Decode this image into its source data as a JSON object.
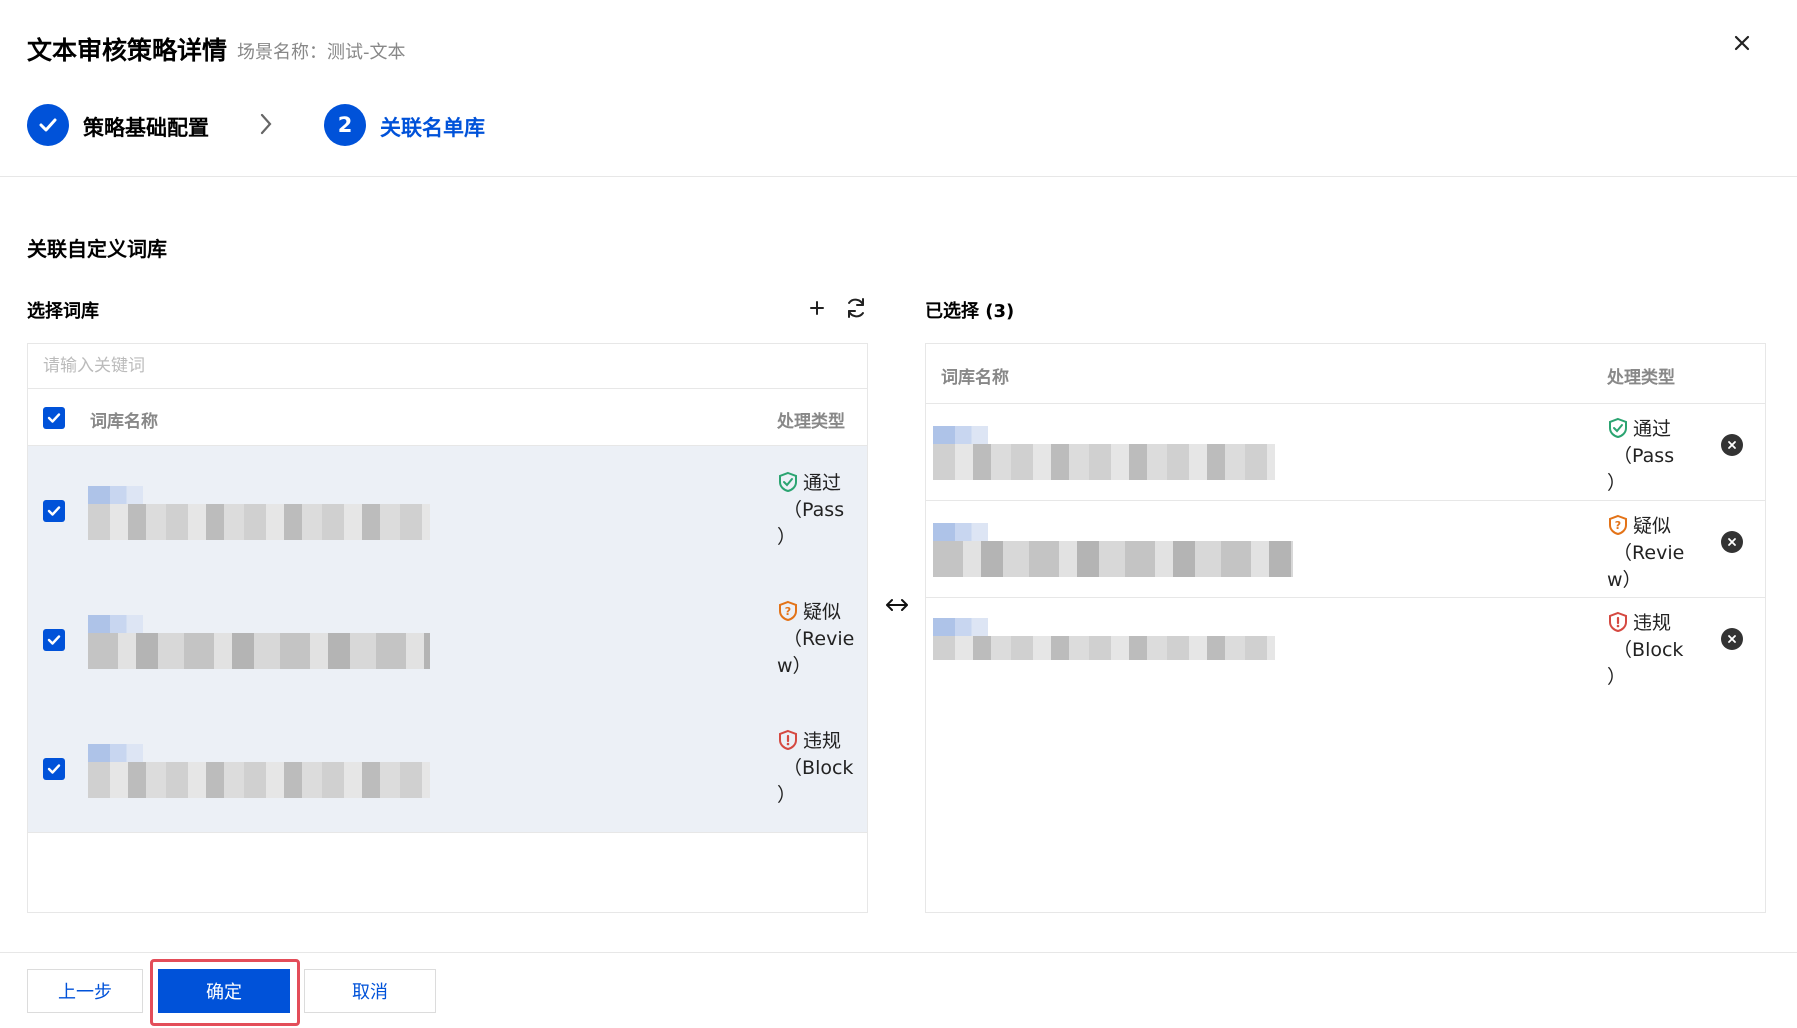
{
  "dialog": {
    "title": "文本审核策略详情",
    "scene": "场景名称：测试-文本"
  },
  "steps": [
    {
      "label": "策略基础配置",
      "status": "done"
    },
    {
      "number": "2",
      "label": "关联名单库",
      "status": "active"
    }
  ],
  "section": {
    "title": "关联自定义词库"
  },
  "left": {
    "title": "选择词库",
    "search_placeholder": "请输入关键词",
    "col_name": "词库名称",
    "col_type": "处理类型"
  },
  "right": {
    "title": "已选择 (3)",
    "col_name": "词库名称",
    "col_type": "处理类型"
  },
  "types": [
    {
      "label": "通过",
      "code": "（Pass",
      "close": "）",
      "color": "#2ba471",
      "icon": "shield-check-icon"
    },
    {
      "label": "疑似",
      "code": "（Revie",
      "close": "w）",
      "color": "#e37318",
      "icon": "shield-question-icon"
    },
    {
      "label": "违规",
      "code": "（Block",
      "close": "）",
      "color": "#d54941",
      "icon": "shield-alert-icon"
    }
  ],
  "footer": {
    "prev": "上一步",
    "confirm": "确定",
    "cancel": "取消"
  },
  "colors": {
    "primary": "#0052d9",
    "pass": "#2ba471",
    "review": "#e37318",
    "block": "#d54941",
    "highlight": "#e34d59"
  }
}
